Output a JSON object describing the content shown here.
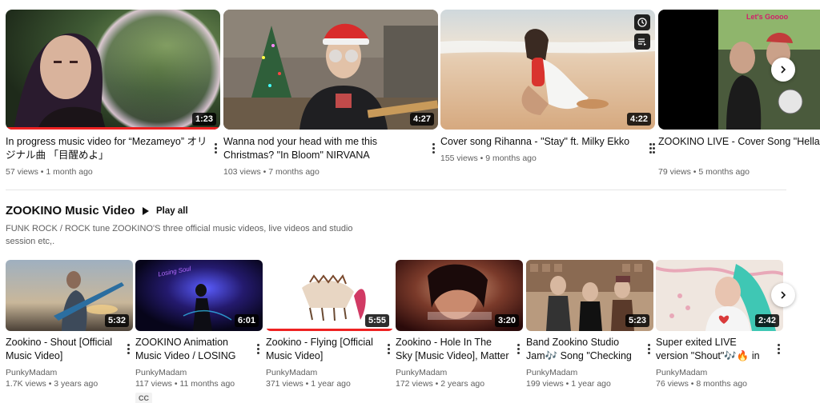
{
  "top_shelf": {
    "videos": [
      {
        "title": "In progress music video for “Mezameyo” オリジナル曲 「目醒めよ」",
        "duration": "1:23",
        "views": "57 views",
        "age": "1 month ago",
        "progress": 1.0
      },
      {
        "title": "Wanna nod your head with me this Christmas? \"In Bloom\" NIRVANA",
        "duration": "4:27",
        "views": "103 views",
        "age": "7 months ago",
        "progress": 0
      },
      {
        "title": "Cover song Rihanna - \"Stay\" ft. Milky Ekko",
        "duration": "4:22",
        "views": "155 views",
        "age": "9 months ago",
        "progress": 0
      },
      {
        "title": "ZOOKINO LIVE - Cover Song \"Hella Doubt)",
        "thumb_text": "Let's Goooo",
        "views": "79 views",
        "age": "5 months ago",
        "progress": 0
      }
    ],
    "next_icon": "chevron-right-icon",
    "hover_icons": [
      "clock-icon",
      "queue-icon"
    ]
  },
  "section": {
    "title": "ZOOKINO Music Video",
    "play_all": "Play all",
    "description": "FUNK ROCK / ROCK tune ZOOKINO'S three official music videos, live videos and studio session etc,."
  },
  "bottom_shelf": {
    "videos": [
      {
        "title": "Zookino - Shout [Official Music Video]",
        "duration": "5:32",
        "channel": "PunkyMadam",
        "views": "1.7K views",
        "age": "3 years ago",
        "progress": 0
      },
      {
        "title": "ZOOKINO Animation Music Video / LOSING SOUL ~ wit...",
        "thumb_text": "Losing Soul",
        "duration": "6:01",
        "channel": "PunkyMadam",
        "views": "117 views",
        "age": "11 months ago",
        "badge": "CC",
        "progress": 0
      },
      {
        "title": "Zookino - Flying [Official Music Video]",
        "duration": "5:55",
        "channel": "PunkyMadam",
        "views": "371 views",
        "age": "1 year ago",
        "progress": 1.0
      },
      {
        "title": "Zookino - Hole In The Sky [Music Video], Matter of...",
        "duration": "3:20",
        "channel": "PunkyMadam",
        "views": "172 views",
        "age": "2 years ago",
        "progress": 0
      },
      {
        "title": "Band Zookino Studio Jam🎶 Song \"Checking U Out\"",
        "duration": "5:23",
        "channel": "PunkyMadam",
        "views": "199 views",
        "age": "1 year ago",
        "progress": 0
      },
      {
        "title": "Super exited LIVE version \"Shout\"🎶🔥 in NYC -...",
        "duration": "2:42",
        "channel": "PunkyMadam",
        "views": "76 views",
        "age": "8 months ago",
        "progress": 0
      }
    ],
    "next_icon": "chevron-right-icon"
  },
  "colors": {
    "progress": "#e22222",
    "text_primary": "#0f0f0f",
    "text_secondary": "#606060"
  }
}
